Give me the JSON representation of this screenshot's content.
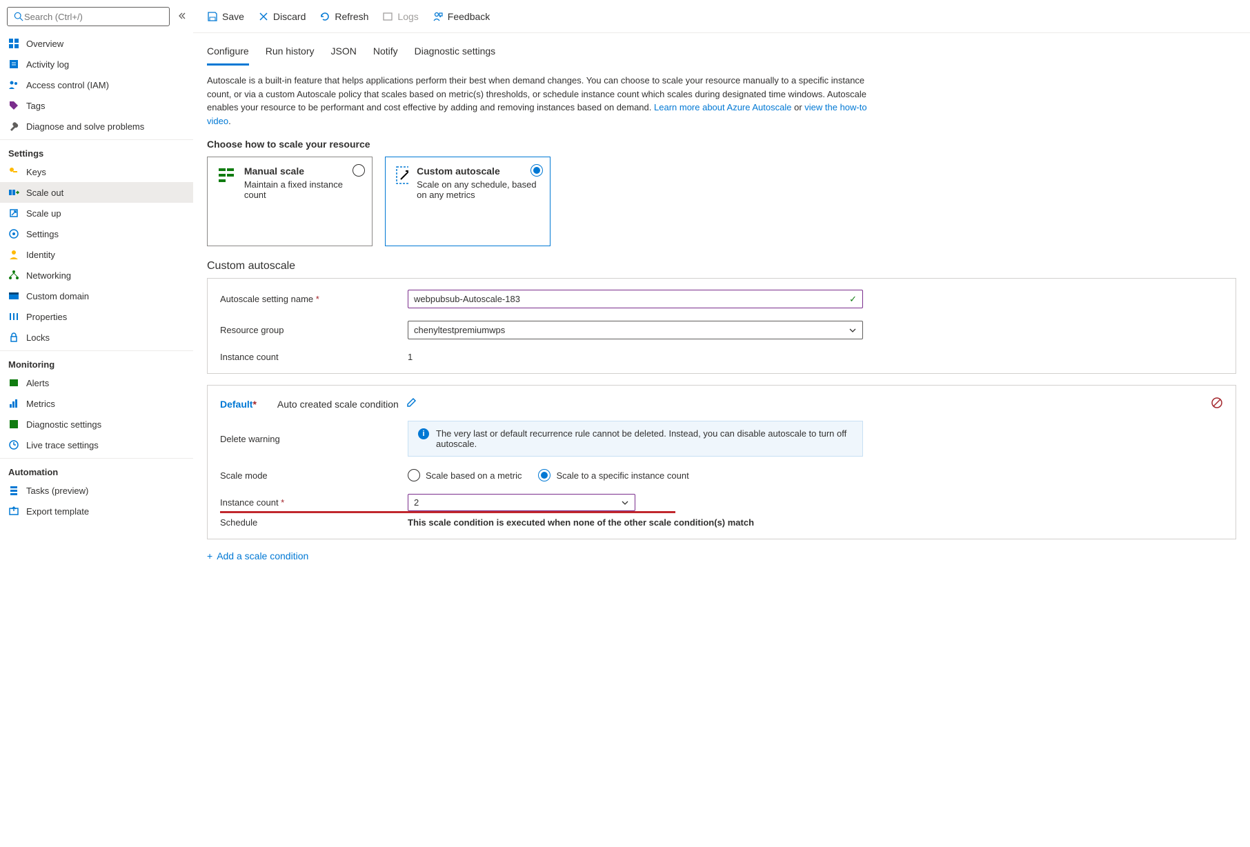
{
  "search": {
    "placeholder": "Search (Ctrl+/)"
  },
  "nav": {
    "overview": "Overview",
    "activity_log": "Activity log",
    "access_control": "Access control (IAM)",
    "tags": "Tags",
    "diagnose": "Diagnose and solve problems",
    "settings_group": "Settings",
    "keys": "Keys",
    "scale_out": "Scale out",
    "scale_up": "Scale up",
    "settings": "Settings",
    "identity": "Identity",
    "networking": "Networking",
    "custom_domain": "Custom domain",
    "properties": "Properties",
    "locks": "Locks",
    "monitoring_group": "Monitoring",
    "alerts": "Alerts",
    "metrics": "Metrics",
    "diag_settings": "Diagnostic settings",
    "live_trace": "Live trace settings",
    "automation_group": "Automation",
    "tasks": "Tasks (preview)",
    "export_template": "Export template"
  },
  "toolbar": {
    "save": "Save",
    "discard": "Discard",
    "refresh": "Refresh",
    "logs": "Logs",
    "feedback": "Feedback"
  },
  "tabs": {
    "configure": "Configure",
    "run_history": "Run history",
    "json": "JSON",
    "notify": "Notify",
    "diag": "Diagnostic settings"
  },
  "intro": {
    "text1": "Autoscale is a built-in feature that helps applications perform their best when demand changes. You can choose to scale your resource manually to a specific instance count, or via a custom Autoscale policy that scales based on metric(s) thresholds, or schedule instance count which scales during designated time windows. Autoscale enables your resource to be performant and cost effective by adding and removing instances based on demand. ",
    "link1": "Learn more about Azure Autoscale",
    "text2": " or ",
    "link2": "view the how-to video",
    "text3": "."
  },
  "choose_heading": "Choose how to scale your resource",
  "cards": {
    "manual_title": "Manual scale",
    "manual_desc": "Maintain a fixed instance count",
    "custom_title": "Custom autoscale",
    "custom_desc": "Scale on any schedule, based on any metrics"
  },
  "section_custom": "Custom autoscale",
  "form": {
    "setting_name_label": "Autoscale setting name",
    "setting_name_value": "webpubsub-Autoscale-183",
    "resource_group_label": "Resource group",
    "resource_group_value": "chenyltestpremiumwps",
    "instance_count_label": "Instance count",
    "instance_count_value": "1"
  },
  "condition": {
    "title": "Default",
    "subtitle": "Auto created scale condition",
    "delete_warning_label": "Delete warning",
    "delete_warning_text": "The very last or default recurrence rule cannot be deleted. Instead, you can disable autoscale to turn off autoscale.",
    "scale_mode_label": "Scale mode",
    "scale_mode_metric": "Scale based on a metric",
    "scale_mode_specific": "Scale to a specific instance count",
    "instance_count_label": "Instance count",
    "instance_count_value": "2",
    "schedule_label": "Schedule",
    "schedule_note": "This scale condition is executed when none of the other scale condition(s) match"
  },
  "add_condition": "Add a scale condition"
}
